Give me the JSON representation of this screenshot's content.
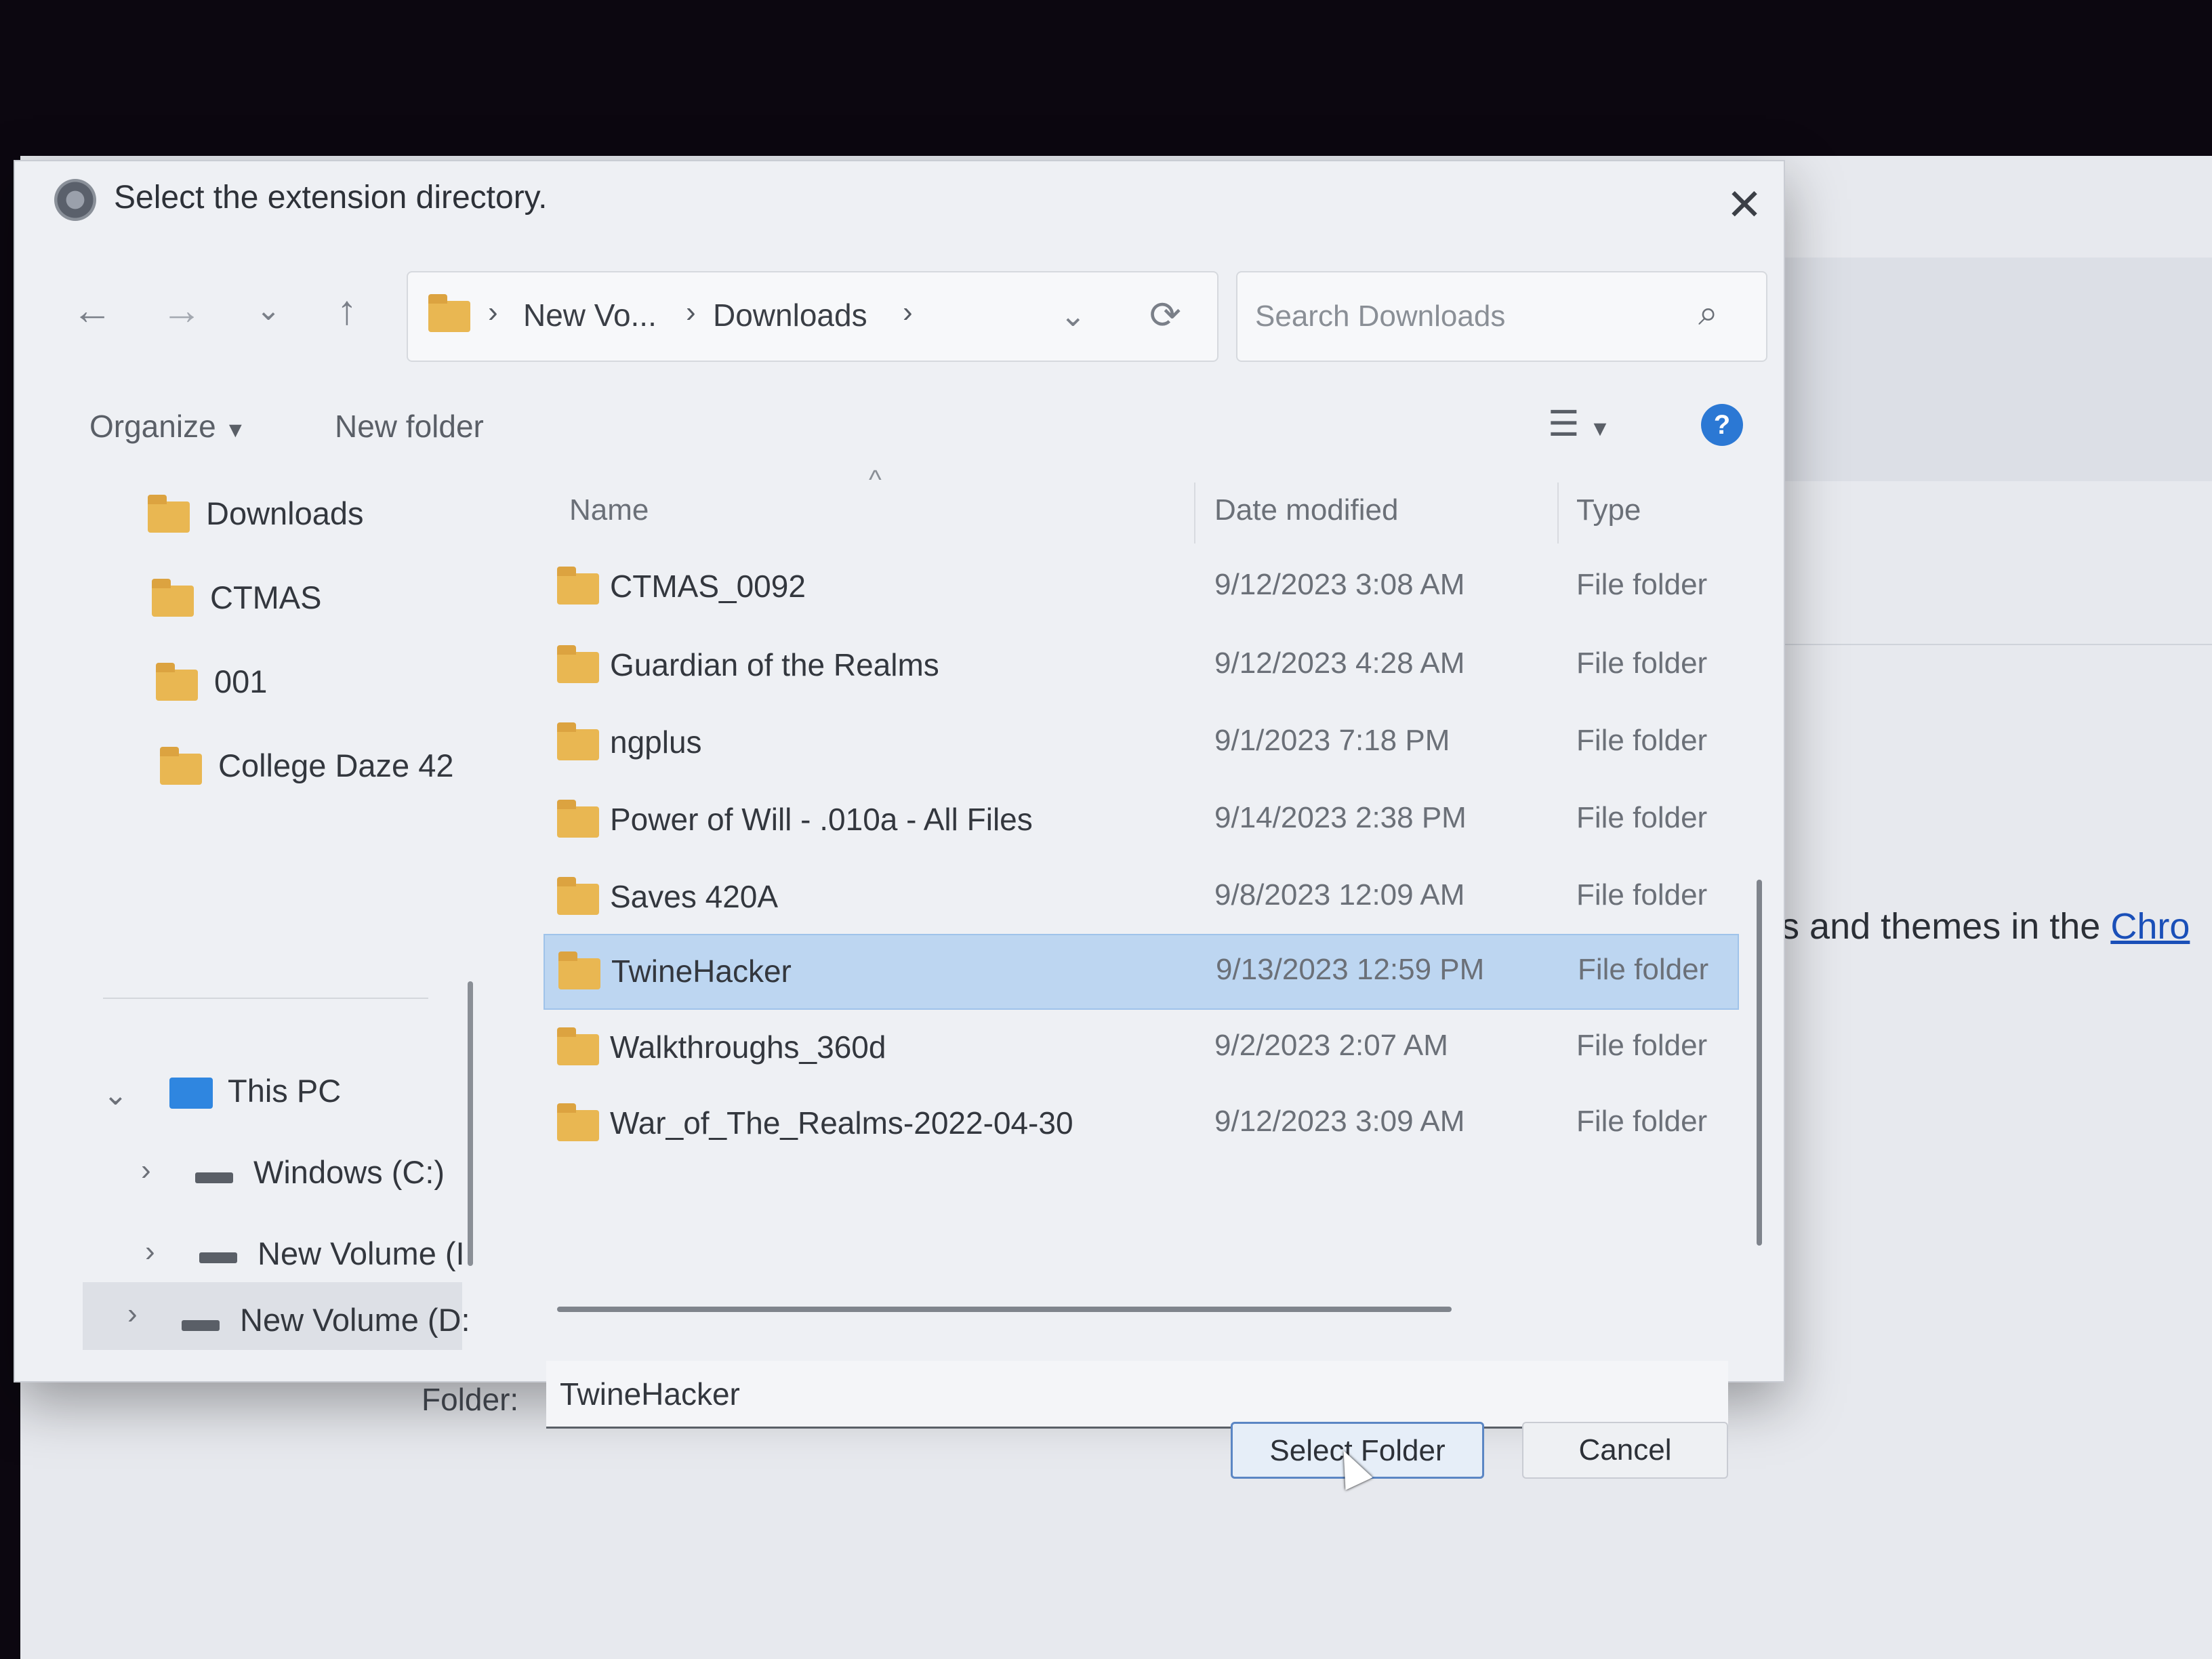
{
  "background": {
    "snippet": "ns and themes in the ",
    "link_text": "Chro"
  },
  "dialog": {
    "title": "Select the extension directory.",
    "close_icon": "close-icon"
  },
  "nav": {
    "back_icon": "←",
    "forward_icon": "→",
    "recent_icon": "⌄",
    "up_icon": "↑",
    "breadcrumbs": [
      "New Vo...",
      "Downloads"
    ],
    "refresh_icon": "⟳",
    "dropdown_icon": "⌄"
  },
  "search": {
    "placeholder": "Search Downloads"
  },
  "toolbar": {
    "organize": "Organize",
    "new_folder": "New folder",
    "help": "?"
  },
  "navpane": {
    "quick": [
      "Downloads",
      "CTMAS",
      "001",
      "College Daze 42"
    ],
    "this_pc": "This PC",
    "drives": [
      "Windows (C:)",
      "New Volume (I",
      "New Volume (D:"
    ]
  },
  "list": {
    "headers": {
      "name": "Name",
      "date": "Date modified",
      "type": "Type"
    },
    "rows": [
      {
        "name": "CTMAS_0092",
        "date": "9/12/2023 3:08 AM",
        "type": "File folder"
      },
      {
        "name": "Guardian of the Realms",
        "date": "9/12/2023 4:28 AM",
        "type": "File folder"
      },
      {
        "name": "ngplus",
        "date": "9/1/2023 7:18 PM",
        "type": "File folder"
      },
      {
        "name": "Power of Will - .010a - All Files",
        "date": "9/14/2023 2:38 PM",
        "type": "File folder"
      },
      {
        "name": "Saves 420A",
        "date": "9/8/2023 12:09 AM",
        "type": "File folder"
      },
      {
        "name": "TwineHacker",
        "date": "9/13/2023 12:59 PM",
        "type": "File folder"
      },
      {
        "name": "Walkthroughs_360d",
        "date": "9/2/2023 2:07 AM",
        "type": "File folder"
      },
      {
        "name": "War_of_The_Realms-2022-04-30",
        "date": "9/12/2023 3:09 AM",
        "type": "File folder"
      }
    ],
    "selected_index": 5
  },
  "footer": {
    "folder_label": "Folder:",
    "folder_value": "TwineHacker",
    "select_button": "Select Folder",
    "cancel_button": "Cancel"
  },
  "colors": {
    "accent": "#2b78d4",
    "selection": "#bdd6f1",
    "folder": "#e9b752"
  }
}
